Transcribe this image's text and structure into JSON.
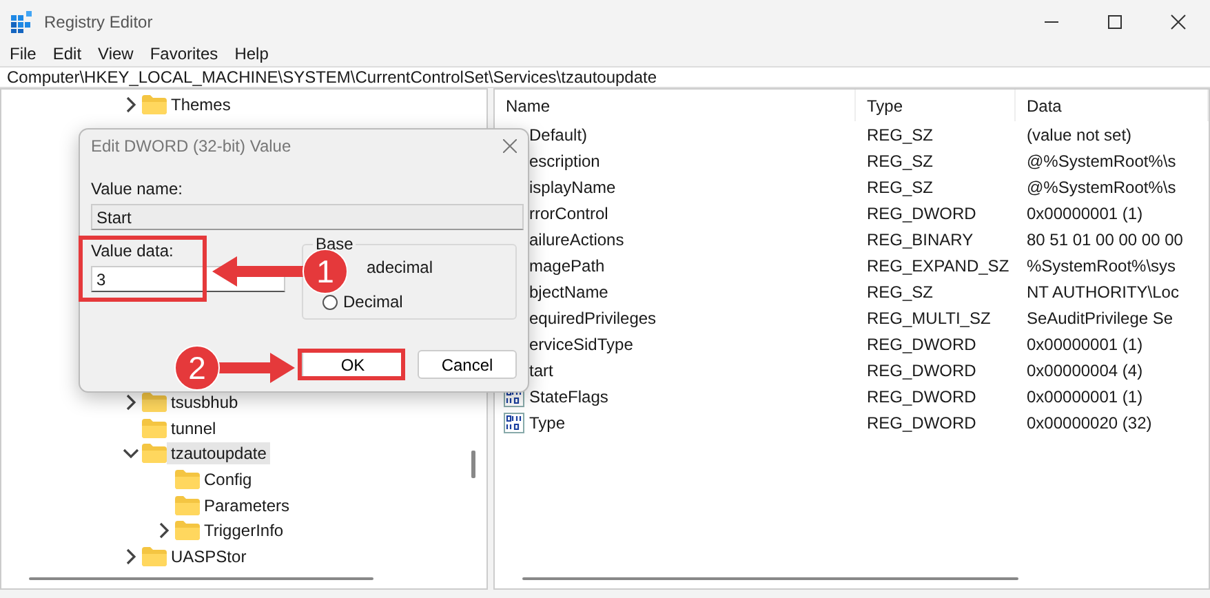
{
  "window": {
    "title": "Registry Editor"
  },
  "menu": [
    "File",
    "Edit",
    "View",
    "Favorites",
    "Help"
  ],
  "address": "Computer\\HKEY_LOCAL_MACHINE\\SYSTEM\\CurrentControlSet\\Services\\tzautoupdate",
  "tree": [
    {
      "label": "Themes",
      "expanded": false,
      "selected": false
    },
    {
      "label": "tsusbhub",
      "expanded": false,
      "selected": false
    },
    {
      "label": "tunnel",
      "selected": false
    },
    {
      "label": "tzautoupdate",
      "expanded": true,
      "selected": true,
      "children": [
        {
          "label": "Config",
          "selected": false
        },
        {
          "label": "Parameters",
          "selected": false
        },
        {
          "label": "TriggerInfo",
          "expanded": false,
          "selected": false
        }
      ]
    },
    {
      "label": "UASPStor",
      "expanded": false,
      "selected": false
    }
  ],
  "table": {
    "columns": [
      "Name",
      "Type",
      "Data"
    ],
    "rows": [
      {
        "name": "Default)",
        "type": "REG_SZ",
        "data": "(value not set)"
      },
      {
        "name": "escription",
        "type": "REG_SZ",
        "data": "@%SystemRoot%\\s"
      },
      {
        "name": "isplayName",
        "type": "REG_SZ",
        "data": "@%SystemRoot%\\s"
      },
      {
        "name": "rrorControl",
        "type": "REG_DWORD",
        "data": "0x00000001 (1)"
      },
      {
        "name": "ailureActions",
        "type": "REG_BINARY",
        "data": "80 51 01 00 00 00 00"
      },
      {
        "name": "magePath",
        "type": "REG_EXPAND_SZ",
        "data": "%SystemRoot%\\sys"
      },
      {
        "name": "bjectName",
        "type": "REG_SZ",
        "data": "NT AUTHORITY\\Loc"
      },
      {
        "name": "equiredPrivileges",
        "type": "REG_MULTI_SZ",
        "data": "SeAuditPrivilege Se"
      },
      {
        "name": "erviceSidType",
        "type": "REG_DWORD",
        "data": "0x00000001 (1)"
      },
      {
        "name": "tart",
        "type": "REG_DWORD",
        "data": "0x00000004 (4)"
      },
      {
        "name": "StateFlags",
        "type": "REG_DWORD",
        "data": "0x00000001 (1)",
        "kind": "binary"
      },
      {
        "name": "Type",
        "type": "REG_DWORD",
        "data": "0x00000020 (32)",
        "kind": "binary"
      }
    ]
  },
  "dialog": {
    "title": "Edit DWORD (32-bit) Value",
    "value_name_label": "Value name:",
    "value_name": "Start",
    "value_data_label": "Value data:",
    "value_data": "3",
    "base_label": "Base",
    "radios": [
      {
        "kind": "covered",
        "label": "adecimal"
      },
      {
        "kind": "radio",
        "label": "Decimal",
        "selected": false
      }
    ],
    "buttons": [
      "OK",
      "Cancel"
    ]
  },
  "annotations": [
    {
      "label": "1"
    },
    {
      "label": "2"
    }
  ]
}
